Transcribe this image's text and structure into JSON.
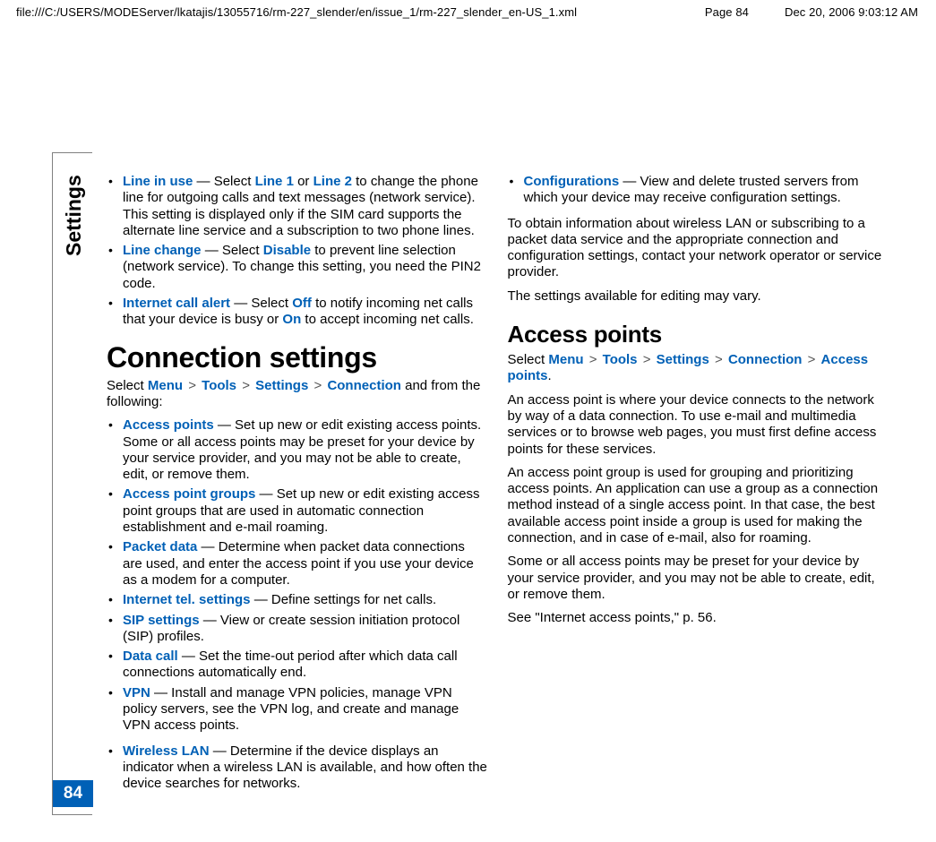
{
  "header": {
    "path": "file:///C:/USERS/MODEServer/lkatajis/13055716/rm-227_slender/en/issue_1/rm-227_slender_en-US_1.xml",
    "page": "Page 84",
    "datetime": "Dec 20, 2006 9:03:12 AM"
  },
  "sidebar": {
    "section": "Settings",
    "page_number": "84"
  },
  "col1": {
    "bul_a": {
      "line_in_use_kw": "Line in use",
      "line_in_use_mid1": " — Select ",
      "line_in_use_opt1": "Line 1",
      "line_in_use_or": " or ",
      "line_in_use_opt2": "Line 2",
      "line_in_use_tail": " to change the phone line for outgoing calls and text messages (network service). This setting is displayed only if the SIM card supports the alternate line service and a subscription to two phone lines.",
      "line_change_kw": "Line change",
      "line_change_mid": " — Select ",
      "line_change_opt": "Disable",
      "line_change_tail": " to prevent line selection (network service). To change this setting, you need the PIN2 code.",
      "ica_kw": "Internet call alert",
      "ica_mid1": " — Select ",
      "ica_opt1": "Off",
      "ica_mid2": " to notify incoming net calls that your device is busy or ",
      "ica_opt2": "On",
      "ica_tail": " to accept incoming net calls."
    },
    "h_connection": "Connection settings",
    "crumb1": {
      "pre": "Select ",
      "m": "Menu",
      "t": "Tools",
      "s": "Settings",
      "c": "Connection",
      "post": " and from the following:",
      "gt": ">"
    },
    "bul_b": {
      "ap_kw": "Access points",
      "ap_txt": " — Set up new or edit existing access points. Some or all access points may be preset for your device by your service provider, and you may not be able to create, edit, or remove them.",
      "apg_kw": "Access point groups",
      "apg_txt": " — Set up new or edit existing access point groups that are used in automatic connection establishment and e-mail roaming.",
      "pd_kw": "Packet data",
      "pd_txt": " — Determine when packet data connections are used, and enter the access point if you use your device as a modem for a computer.",
      "its_kw": "Internet tel. settings",
      "its_txt": " — Define settings for net calls.",
      "sip_kw": "SIP settings",
      "sip_txt": " — View or create session initiation protocol (SIP) profiles.",
      "dc_kw": "Data call",
      "dc_txt": " — Set the time-out period after which data call connections automatically end.",
      "vpn_kw": "VPN",
      "vpn_txt": " — Install and manage VPN policies, manage VPN policy servers, see the VPN log, and create and manage VPN access points."
    }
  },
  "col2": {
    "bul_c": {
      "wlan_kw": "Wireless LAN",
      "wlan_txt": " — Determine if the device displays an indicator when a wireless LAN is available, and how often the device searches for networks.",
      "cfg_kw": "Configurations",
      "cfg_txt": " — View and delete trusted servers from which your device may receive configuration settings."
    },
    "p1": "To obtain information about wireless LAN or subscribing to a packet data service and the appropriate connection and configuration settings, contact your network operator or service provider.",
    "p2": "The settings available for editing may vary.",
    "h_access": "Access points",
    "crumb2": {
      "pre": "Select ",
      "m": "Menu",
      "t": "Tools",
      "s": "Settings",
      "c": "Connection",
      "ap": "Access points",
      "gt": ">",
      "dot": "."
    },
    "p3": "An access point is where your device connects to the network by way of a data connection. To use e-mail and multimedia services or to browse web pages, you must first define access points for these services.",
    "p4": "An access point group is used for grouping and prioritizing access points. An application can use a group as a connection method instead of a single access point. In that case, the best available access point inside a group is used for making the connection, and in case of e-mail, also for roaming.",
    "p5": "Some or all access points may be preset for your device by your service provider, and you may not be able to create, edit, or remove them.",
    "p6": "See \"Internet access points,\" p. 56."
  }
}
